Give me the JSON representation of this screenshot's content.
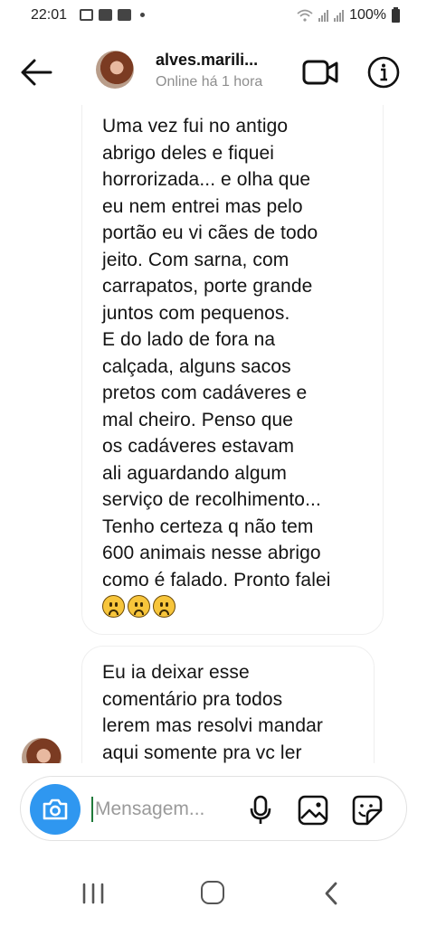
{
  "status_bar": {
    "time": "22:01",
    "battery": "100%"
  },
  "header": {
    "contact_name": "alves.marili...",
    "contact_status": "Online há 1 hora"
  },
  "messages": [
    {
      "text": "Uma vez fui no antigo\nabrigo deles e fiquei\nhorrorizada... e olha que\neu nem entrei mas pelo\nportão eu vi cães de todo\njeito. Com sarna, com\ncarrapatos, porte grande\njuntos com pequenos.\nE do lado de fora na\ncalçada, alguns sacos\npretos com cadáveres e\nmal cheiro. Penso que\nos cadáveres estavam\nali aguardando algum\nserviço de recolhimento...\nTenho certeza q não tem\n600 animais nesse abrigo\ncomo é falado. Pronto falei",
      "emoji": [
        "frowning-face",
        "frowning-face",
        "frowning-face"
      ]
    },
    {
      "text": "Eu ia deixar esse\ncomentário pra todos\nlerem mas resolvi mandar\naqui somente pra vc ler"
    }
  ],
  "composer": {
    "placeholder": "Mensagem...",
    "value": ""
  },
  "icons": {
    "back": "arrow-left-icon",
    "video": "video-call-icon",
    "info": "info-icon",
    "camera": "camera-icon",
    "mic": "microphone-icon",
    "gallery": "gallery-icon",
    "sticker": "sticker-icon"
  },
  "colors": {
    "accent": "#2f97f0",
    "status_text": "#8e8e8e",
    "bubble_border": "#efefef"
  }
}
